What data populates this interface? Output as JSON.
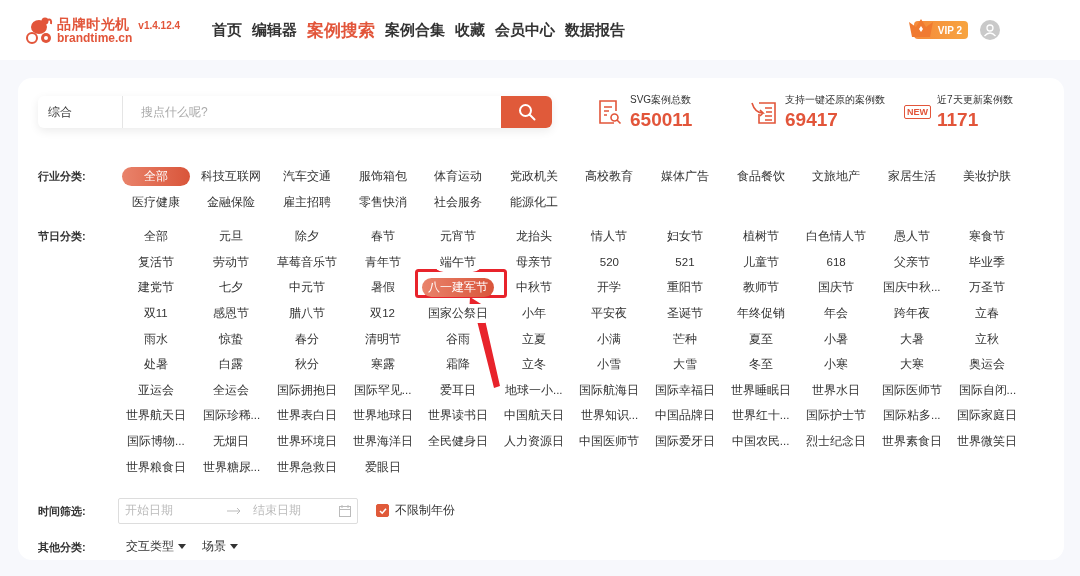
{
  "header": {
    "logo": {
      "name": "品牌时光机",
      "domain": "brandtime.cn",
      "version": "v1.4.12.4"
    },
    "nav": [
      {
        "label": "首页",
        "selected": false
      },
      {
        "label": "编辑器",
        "selected": false
      },
      {
        "label": "案例搜索",
        "selected": true
      },
      {
        "label": "案例合集",
        "selected": false
      },
      {
        "label": "收藏",
        "selected": false
      },
      {
        "label": "会员中心",
        "selected": false
      },
      {
        "label": "数据报告",
        "selected": false
      }
    ],
    "vip_badge": "VIP 2"
  },
  "search": {
    "scope": "综合",
    "placeholder": "搜点什么呢?"
  },
  "stats": [
    {
      "kind": "document",
      "label": "SVG案例总数",
      "value": "650011"
    },
    {
      "kind": "restore",
      "label": "支持一键还原的案例数",
      "value": "69417"
    },
    {
      "kind": "new",
      "badge": "NEW",
      "label": "近7天更新案例数",
      "value": "1171"
    }
  ],
  "industry": {
    "label": "行业分类:",
    "items": [
      {
        "label": "全部",
        "selected": true
      },
      {
        "label": "科技互联网",
        "selected": false
      },
      {
        "label": "汽车交通",
        "selected": false
      },
      {
        "label": "服饰箱包",
        "selected": false
      },
      {
        "label": "体育运动",
        "selected": false
      },
      {
        "label": "党政机关",
        "selected": false
      },
      {
        "label": "高校教育",
        "selected": false
      },
      {
        "label": "媒体广告",
        "selected": false
      },
      {
        "label": "食品餐饮",
        "selected": false
      },
      {
        "label": "文旅地产",
        "selected": false
      },
      {
        "label": "家居生活",
        "selected": false
      },
      {
        "label": "美妆护肤",
        "selected": false
      },
      {
        "label": "医疗健康",
        "selected": false
      },
      {
        "label": "金融保险",
        "selected": false
      },
      {
        "label": "雇主招聘",
        "selected": false
      },
      {
        "label": "零售快消",
        "selected": false
      },
      {
        "label": "社会服务",
        "selected": false
      },
      {
        "label": "能源化工",
        "selected": false
      }
    ]
  },
  "festival": {
    "label": "节日分类:",
    "items": [
      {
        "label": "全部",
        "selected": false
      },
      {
        "label": "元旦",
        "selected": false
      },
      {
        "label": "除夕",
        "selected": false
      },
      {
        "label": "春节",
        "selected": false
      },
      {
        "label": "元宵节",
        "selected": false
      },
      {
        "label": "龙抬头",
        "selected": false
      },
      {
        "label": "情人节",
        "selected": false
      },
      {
        "label": "妇女节",
        "selected": false
      },
      {
        "label": "植树节",
        "selected": false
      },
      {
        "label": "白色情人节",
        "selected": false
      },
      {
        "label": "愚人节",
        "selected": false
      },
      {
        "label": "寒食节",
        "selected": false
      },
      {
        "label": "复活节",
        "selected": false
      },
      {
        "label": "劳动节",
        "selected": false
      },
      {
        "label": "草莓音乐节",
        "selected": false
      },
      {
        "label": "青年节",
        "selected": false
      },
      {
        "label": "端午节",
        "selected": false
      },
      {
        "label": "母亲节",
        "selected": false
      },
      {
        "label": "520",
        "selected": false
      },
      {
        "label": "521",
        "selected": false
      },
      {
        "label": "儿童节",
        "selected": false
      },
      {
        "label": "618",
        "selected": false
      },
      {
        "label": "父亲节",
        "selected": false
      },
      {
        "label": "毕业季",
        "selected": false
      },
      {
        "label": "建党节",
        "selected": false
      },
      {
        "label": "七夕",
        "selected": false
      },
      {
        "label": "中元节",
        "selected": false
      },
      {
        "label": "暑假",
        "selected": false
      },
      {
        "label": "八一建军节",
        "selected": true
      },
      {
        "label": "中秋节",
        "selected": false
      },
      {
        "label": "开学",
        "selected": false
      },
      {
        "label": "重阳节",
        "selected": false
      },
      {
        "label": "教师节",
        "selected": false
      },
      {
        "label": "国庆节",
        "selected": false
      },
      {
        "label": "国庆中秋...",
        "selected": false
      },
      {
        "label": "万圣节",
        "selected": false
      },
      {
        "label": "双11",
        "selected": false
      },
      {
        "label": "感恩节",
        "selected": false
      },
      {
        "label": "腊八节",
        "selected": false
      },
      {
        "label": "双12",
        "selected": false
      },
      {
        "label": "国家公祭日",
        "selected": false
      },
      {
        "label": "小年",
        "selected": false
      },
      {
        "label": "平安夜",
        "selected": false
      },
      {
        "label": "圣诞节",
        "selected": false
      },
      {
        "label": "年终促销",
        "selected": false
      },
      {
        "label": "年会",
        "selected": false
      },
      {
        "label": "跨年夜",
        "selected": false
      },
      {
        "label": "立春",
        "selected": false
      },
      {
        "label": "雨水",
        "selected": false
      },
      {
        "label": "惊蛰",
        "selected": false
      },
      {
        "label": "春分",
        "selected": false
      },
      {
        "label": "清明节",
        "selected": false
      },
      {
        "label": "谷雨",
        "selected": false
      },
      {
        "label": "立夏",
        "selected": false
      },
      {
        "label": "小满",
        "selected": false
      },
      {
        "label": "芒种",
        "selected": false
      },
      {
        "label": "夏至",
        "selected": false
      },
      {
        "label": "小暑",
        "selected": false
      },
      {
        "label": "大暑",
        "selected": false
      },
      {
        "label": "立秋",
        "selected": false
      },
      {
        "label": "处暑",
        "selected": false
      },
      {
        "label": "白露",
        "selected": false
      },
      {
        "label": "秋分",
        "selected": false
      },
      {
        "label": "寒露",
        "selected": false
      },
      {
        "label": "霜降",
        "selected": false
      },
      {
        "label": "立冬",
        "selected": false
      },
      {
        "label": "小雪",
        "selected": false
      },
      {
        "label": "大雪",
        "selected": false
      },
      {
        "label": "冬至",
        "selected": false
      },
      {
        "label": "小寒",
        "selected": false
      },
      {
        "label": "大寒",
        "selected": false
      },
      {
        "label": "奥运会",
        "selected": false
      },
      {
        "label": "亚运会",
        "selected": false
      },
      {
        "label": "全运会",
        "selected": false
      },
      {
        "label": "国际拥抱日",
        "selected": false
      },
      {
        "label": "国际罕见...",
        "selected": false
      },
      {
        "label": "爱耳日",
        "selected": false
      },
      {
        "label": "地球一小...",
        "selected": false
      },
      {
        "label": "国际航海日",
        "selected": false
      },
      {
        "label": "国际幸福日",
        "selected": false
      },
      {
        "label": "世界睡眠日",
        "selected": false
      },
      {
        "label": "世界水日",
        "selected": false
      },
      {
        "label": "国际医师节",
        "selected": false
      },
      {
        "label": "国际自闭...",
        "selected": false
      },
      {
        "label": "世界航天日",
        "selected": false
      },
      {
        "label": "国际珍稀...",
        "selected": false
      },
      {
        "label": "世界表白日",
        "selected": false
      },
      {
        "label": "世界地球日",
        "selected": false
      },
      {
        "label": "世界读书日",
        "selected": false
      },
      {
        "label": "中国航天日",
        "selected": false
      },
      {
        "label": "世界知识...",
        "selected": false
      },
      {
        "label": "中国品牌日",
        "selected": false
      },
      {
        "label": "世界红十...",
        "selected": false
      },
      {
        "label": "国际护士节",
        "selected": false
      },
      {
        "label": "国际粘多...",
        "selected": false
      },
      {
        "label": "国际家庭日",
        "selected": false
      },
      {
        "label": "国际博物...",
        "selected": false
      },
      {
        "label": "无烟日",
        "selected": false
      },
      {
        "label": "世界环境日",
        "selected": false
      },
      {
        "label": "世界海洋日",
        "selected": false
      },
      {
        "label": "全民健身日",
        "selected": false
      },
      {
        "label": "人力资源日",
        "selected": false
      },
      {
        "label": "中国医师节",
        "selected": false
      },
      {
        "label": "国际爱牙日",
        "selected": false
      },
      {
        "label": "中国农民...",
        "selected": false
      },
      {
        "label": "烈士纪念日",
        "selected": false
      },
      {
        "label": "世界素食日",
        "selected": false
      },
      {
        "label": "世界微笑日",
        "selected": false
      },
      {
        "label": "世界粮食日",
        "selected": false
      },
      {
        "label": "世界糖尿...",
        "selected": false
      },
      {
        "label": "世界急救日",
        "selected": false
      },
      {
        "label": "爱眼日",
        "selected": false
      }
    ]
  },
  "time_filter": {
    "label": "时间筛选:",
    "start_placeholder": "开始日期",
    "end_placeholder": "结束日期",
    "unlimited_year": {
      "label": "不限制年份",
      "checked": true
    }
  },
  "other": {
    "label": "其他分类:",
    "dropdowns": [
      "交互类型",
      "场景"
    ]
  },
  "annotation": {
    "kind": "arrow"
  }
}
